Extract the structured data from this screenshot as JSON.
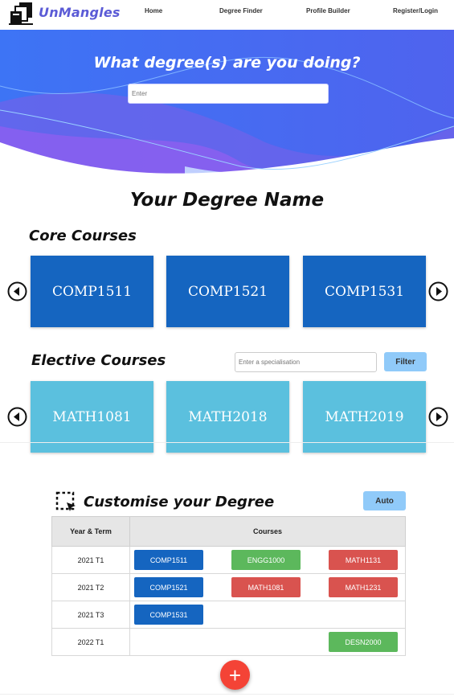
{
  "brand": {
    "name": "UnMangles"
  },
  "nav": {
    "home": "Home",
    "degree_finder": "Degree Finder",
    "profile_builder": "Profile Builder",
    "register": "Register/Login"
  },
  "hero": {
    "title": "What degree(s) are you doing?",
    "input_placeholder": "Enter"
  },
  "degree": {
    "name": "Your Degree Name"
  },
  "core": {
    "title": "Core Courses",
    "courses": [
      "COMP1511",
      "COMP1521",
      "COMP1531"
    ]
  },
  "elective": {
    "title": "Elective Courses",
    "spec_placeholder": "Enter a specialisation",
    "filter_label": "Filter",
    "courses": [
      "MATH1081",
      "MATH2018",
      "MATH2019"
    ]
  },
  "customise": {
    "title": "Customise your Degree",
    "auto_label": "Auto",
    "headers": {
      "term": "Year & Term",
      "courses": "Courses"
    },
    "rows": [
      {
        "term": "2021 T1",
        "slots": [
          {
            "code": "COMP1511",
            "color": "#1565c0"
          },
          {
            "code": "ENGG1000",
            "color": "#5cb85c"
          },
          {
            "code": "MATH1131",
            "color": "#d9534f"
          }
        ]
      },
      {
        "term": "2021 T2",
        "slots": [
          {
            "code": "COMP1521",
            "color": "#1565c0"
          },
          {
            "code": "MATH1081",
            "color": "#d9534f"
          },
          {
            "code": "MATH1231",
            "color": "#d9534f"
          }
        ]
      },
      {
        "term": "2021 T3",
        "slots": [
          {
            "code": "COMP1531",
            "color": "#1565c0"
          },
          null,
          null
        ]
      },
      {
        "term": "2022 T1",
        "slots": [
          null,
          null,
          {
            "code": "DESN2000",
            "color": "#5cb85c"
          }
        ]
      }
    ]
  },
  "fab": {
    "label": "+"
  },
  "colors": {
    "core": "#1565c0",
    "elective": "#5bc0de",
    "accent": "#5b5bd6",
    "fab": "#f44336"
  }
}
